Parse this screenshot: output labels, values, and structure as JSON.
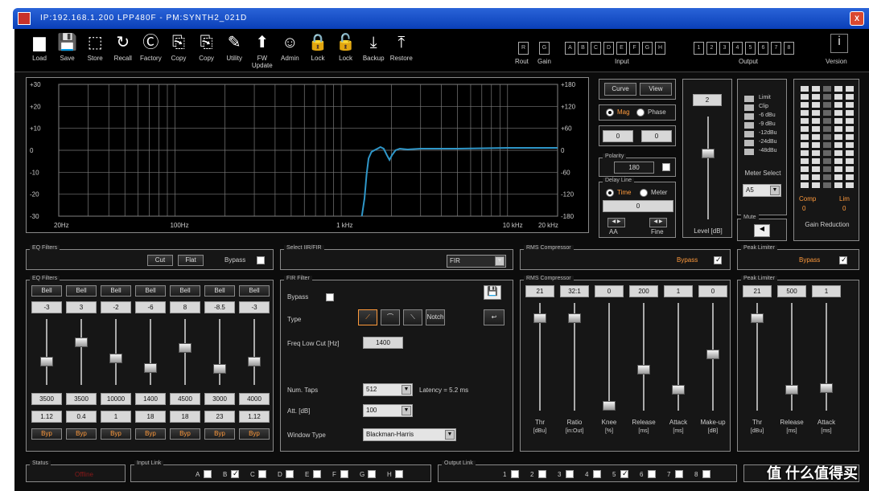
{
  "window": {
    "title": "IP:192.168.1.200 LPP480F - PM:SYNTH2_021D",
    "close_glyph": "X"
  },
  "toolbar": {
    "items": [
      {
        "label": "Load",
        "icon": "folder-icon",
        "glyph": "▆"
      },
      {
        "label": "Save",
        "icon": "floppy-icon",
        "glyph": "💾"
      },
      {
        "label": "Store",
        "icon": "store-icon",
        "glyph": "⬚"
      },
      {
        "label": "Recall",
        "icon": "recall-icon",
        "glyph": "↻"
      },
      {
        "label": "Factory",
        "icon": "factory-icon",
        "glyph": "Ⓒ"
      },
      {
        "label": "Copy",
        "icon": "copy-icon",
        "glyph": "⎘"
      },
      {
        "label": "Copy",
        "icon": "copy2-icon",
        "glyph": "⎘"
      },
      {
        "label": "Utility",
        "icon": "wrench-icon",
        "glyph": "✎"
      },
      {
        "label": "FW Update",
        "icon": "update-icon",
        "glyph": "⬆"
      },
      {
        "label": "Admin",
        "icon": "admin-icon",
        "glyph": "☺"
      },
      {
        "label": "Lock",
        "icon": "lock-icon",
        "glyph": "🔒"
      },
      {
        "label": "Lock",
        "icon": "lock2-icon",
        "glyph": "🔓"
      },
      {
        "label": "Backup",
        "icon": "backup-icon",
        "glyph": "⤓"
      },
      {
        "label": "Restore",
        "icon": "restore-icon",
        "glyph": "⤒"
      }
    ],
    "rout_label": "Rout",
    "gain_label": "Gain",
    "rout_btn": "R",
    "gain_btn": "G",
    "input_label": "Input",
    "output_label": "Output",
    "input_channels": [
      "A",
      "B",
      "C",
      "D",
      "E",
      "F",
      "G",
      "H"
    ],
    "output_channels": [
      "1",
      "2",
      "3",
      "4",
      "5",
      "6",
      "7",
      "8"
    ],
    "version_label": "Version",
    "version_glyph": "i"
  },
  "graph": {
    "left_ticks": [
      "+30",
      "+20",
      "+10",
      "0",
      "-10",
      "-20",
      "-30"
    ],
    "right_ticks": [
      "+180",
      "+120",
      "+60",
      "0",
      "-60",
      "-120",
      "-180"
    ],
    "x_ticks": [
      "20Hz",
      "100Hz",
      "1 kHz",
      "10 kHz",
      "20 kHz"
    ]
  },
  "side": {
    "curve_btn": "Curve",
    "view_btn": "View",
    "mag_label": "Mag",
    "phase_label": "Phase",
    "delay_values": [
      "0",
      "0"
    ],
    "polarity_title": "Polarity",
    "polarity_value": "180",
    "delay_title": "Delay Line",
    "time_label": "Time",
    "meter_label": "Meter",
    "delay_display": "0",
    "nudge_a": "◀ ▶",
    "nudge_b": "◀ ▶",
    "fine_a": "AA",
    "fine_b": "Fine",
    "level_value": "2",
    "level_label": "Level [dB]",
    "meter_legend": [
      "Limit",
      "Clip",
      "-6 dBu",
      "-9 dBu",
      "-12dBu",
      "-24dBu",
      "-48dBu"
    ],
    "meter_select_label": "Meter Select",
    "meter_select_value": "A5",
    "mute_title": "Mute",
    "mute_glyph": "◀",
    "gain_reduction_label": "Gain Reduction",
    "comp_label": "Comp",
    "lim_label": "Lim",
    "comp_value": "0",
    "lim_value": "0"
  },
  "eq_filters_bar": {
    "title": "EQ Filters",
    "cut_btn": "Cut",
    "flat_btn": "Flat",
    "bypass_label": "Bypass"
  },
  "select_fir": {
    "title": "Select IIR/FIR",
    "value": "FIR"
  },
  "rms_bar": {
    "title": "RMS Compressor",
    "bypass_label": "Bypass"
  },
  "peak_bar": {
    "title": "Peak Limiter",
    "bypass_label": "Bypass"
  },
  "eq": {
    "title": "EQ Filters",
    "bands": [
      {
        "type": "Bell",
        "gain": "-3",
        "freq": "3500",
        "q": "1.12",
        "fill": 0.4
      },
      {
        "type": "Bell",
        "gain": "3",
        "freq": "3500",
        "q": "0.4",
        "fill": 0.7
      },
      {
        "type": "Bell",
        "gain": "-2",
        "freq": "10000",
        "q": "1",
        "fill": 0.45
      },
      {
        "type": "Bell",
        "gain": "-6",
        "freq": "1400",
        "q": "18",
        "fill": 0.3
      },
      {
        "type": "Bell",
        "gain": "8",
        "freq": "4500",
        "q": "18",
        "fill": 0.62
      },
      {
        "type": "Bell",
        "gain": "-8.5",
        "freq": "3000",
        "q": "23",
        "fill": 0.28
      },
      {
        "type": "Bell",
        "gain": "-3",
        "freq": "4000",
        "q": "1.12",
        "fill": 0.4
      }
    ],
    "bypass_btn": "Byp"
  },
  "fir": {
    "title": "FIR Filter",
    "bypass_label": "Bypass",
    "type_label": "Type",
    "freq_label": "Freq Low Cut [Hz]",
    "freq_value": "1400",
    "taps_label": "Num. Taps",
    "taps_value": "512",
    "latency_text": "Latency = 5.2 ms",
    "att_label": "Att. [dB]",
    "att_value": "100",
    "window_label": "Window Type",
    "window_value": "Blackman-Harris",
    "type_glyphs": [
      "⟋",
      "⌒",
      "⟍",
      "Notch"
    ],
    "save_glyph": "💾",
    "reload_glyph": "↩"
  },
  "rms": {
    "title": "RMS Compressor",
    "params": [
      {
        "value": "21",
        "label": "Thr",
        "unit": "[dBu]",
        "fill": 0.9
      },
      {
        "value": "32:1",
        "label": "Ratio",
        "unit": "[in:Out]",
        "fill": 0.9
      },
      {
        "value": "0",
        "label": "Knee",
        "unit": "[%]",
        "fill": 0.05
      },
      {
        "value": "200",
        "label": "Release",
        "unit": "[ms]",
        "fill": 0.4
      },
      {
        "value": "1",
        "label": "Attack",
        "unit": "[ms]",
        "fill": 0.2
      },
      {
        "value": "0",
        "label": "Make-up",
        "unit": "[dB]",
        "fill": 0.55
      }
    ]
  },
  "peak": {
    "title": "Peak Limiter",
    "params": [
      {
        "value": "21",
        "label": "Thr",
        "unit": "[dBu]",
        "fill": 0.9
      },
      {
        "value": "500",
        "label": "Release",
        "unit": "[ms]",
        "fill": 0.2
      },
      {
        "value": "1",
        "label": "Attack",
        "unit": "[ms]",
        "fill": 0.22
      }
    ]
  },
  "status": {
    "status_title": "Status",
    "status_value": "Offline",
    "input_link_title": "Input Link",
    "output_link_title": "Output Link",
    "input_link": [
      "A",
      "B",
      "C",
      "D",
      "E",
      "F",
      "G",
      "H"
    ],
    "output_link": [
      "1",
      "2",
      "3",
      "4",
      "5",
      "6",
      "7",
      "8"
    ]
  },
  "watermark": "值 什么值得买",
  "colors": {
    "curve": "#2f97c9",
    "grid": "#7a7a7a",
    "accent": "#ff9a3c"
  }
}
